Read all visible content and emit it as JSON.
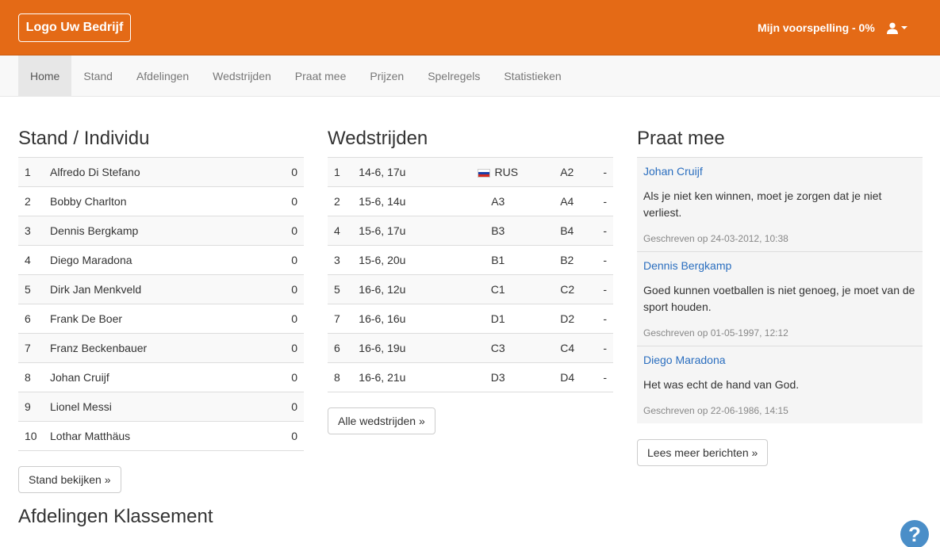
{
  "header": {
    "logo": "Logo Uw Bedrijf",
    "prediction": "Mijn voorspelling - 0%"
  },
  "nav": [
    "Home",
    "Stand",
    "Afdelingen",
    "Wedstrijden",
    "Praat mee",
    "Prijzen",
    "Spelregels",
    "Statistieken"
  ],
  "standings": {
    "title": "Stand / Individu",
    "rows": [
      {
        "rank": "1",
        "name": "Alfredo Di Stefano",
        "points": "0"
      },
      {
        "rank": "2",
        "name": "Bobby Charlton",
        "points": "0"
      },
      {
        "rank": "3",
        "name": "Dennis Bergkamp",
        "points": "0"
      },
      {
        "rank": "4",
        "name": "Diego Maradona",
        "points": "0"
      },
      {
        "rank": "5",
        "name": "Dirk Jan Menkveld",
        "points": "0"
      },
      {
        "rank": "6",
        "name": "Frank De Boer",
        "points": "0"
      },
      {
        "rank": "7",
        "name": "Franz Beckenbauer",
        "points": "0"
      },
      {
        "rank": "8",
        "name": "Johan Cruijf",
        "points": "0"
      },
      {
        "rank": "9",
        "name": "Lionel Messi",
        "points": "0"
      },
      {
        "rank": "10",
        "name": "Lothar Matthäus",
        "points": "0"
      }
    ],
    "button": "Stand bekijken »"
  },
  "departments": {
    "title": "Afdelingen Klassement"
  },
  "matches": {
    "title": "Wedstrijden",
    "rows": [
      {
        "nr": "1",
        "date": "14-6, 17u",
        "home": "RUS",
        "away": "A2",
        "result": "-",
        "flag": "russia-flag-icon"
      },
      {
        "nr": "2",
        "date": "15-6, 14u",
        "home": "A3",
        "away": "A4",
        "result": "-"
      },
      {
        "nr": "4",
        "date": "15-6, 17u",
        "home": "B3",
        "away": "B4",
        "result": "-"
      },
      {
        "nr": "3",
        "date": "15-6, 20u",
        "home": "B1",
        "away": "B2",
        "result": "-"
      },
      {
        "nr": "5",
        "date": "16-6, 12u",
        "home": "C1",
        "away": "C2",
        "result": "-"
      },
      {
        "nr": "7",
        "date": "16-6, 16u",
        "home": "D1",
        "away": "D2",
        "result": "-"
      },
      {
        "nr": "6",
        "date": "16-6, 19u",
        "home": "C3",
        "away": "C4",
        "result": "-"
      },
      {
        "nr": "8",
        "date": "16-6, 21u",
        "home": "D3",
        "away": "D4",
        "result": "-"
      }
    ],
    "button": "Alle wedstrijden »"
  },
  "chat": {
    "title": "Praat mee",
    "posts": [
      {
        "author": "Johan Cruijf",
        "text": "Als je niet ken winnen, moet je zorgen dat je niet verliest.",
        "meta": "Geschreven op 24-03-2012, 10:38"
      },
      {
        "author": "Dennis Bergkamp",
        "text": "Goed kunnen voetballen is niet genoeg, je moet van de sport houden.",
        "meta": "Geschreven op 01-05-1997, 12:12"
      },
      {
        "author": "Diego Maradona",
        "text": "Het was echt de hand van God.",
        "meta": "Geschreven op 22-06-1986, 14:15"
      }
    ],
    "button": "Lees meer berichten »"
  },
  "help": "?",
  "colors": {
    "brand": "#e46a16",
    "link": "#2a6ebf",
    "help": "#4a8ec8"
  }
}
